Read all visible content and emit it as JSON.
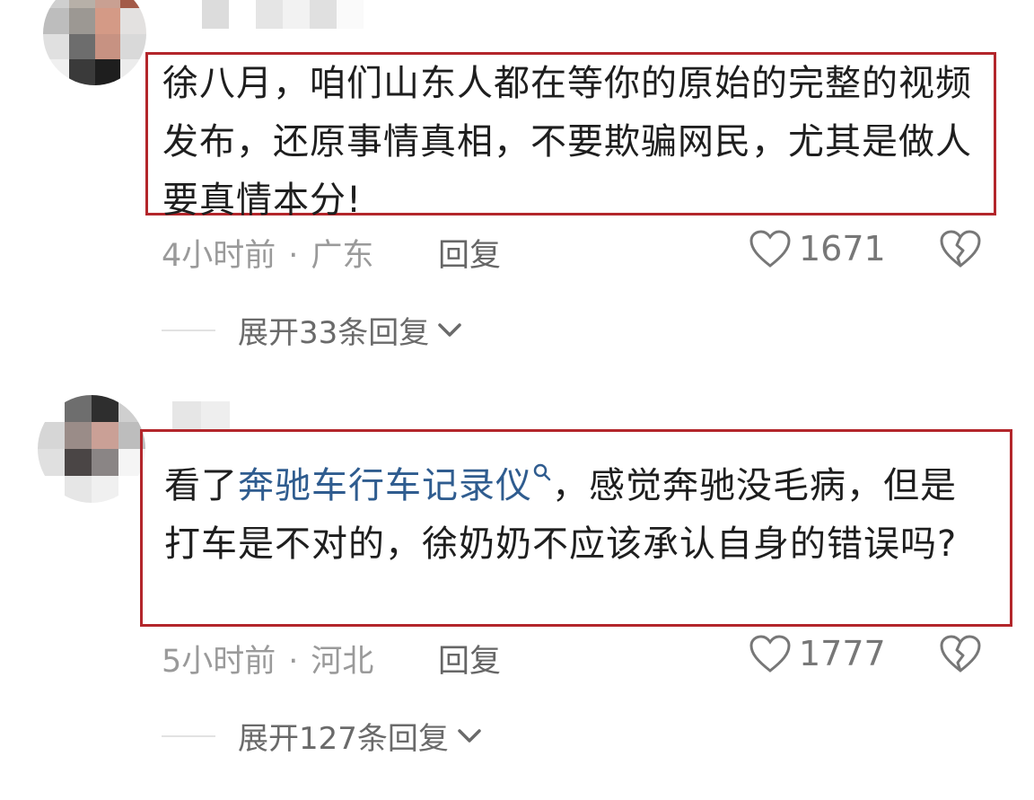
{
  "comments": [
    {
      "text": "徐八月，咱们山东人都在等你的原始的完整的视频发布，还原事情真相，不要欺骗网民，尤其是做人要真情本分!",
      "time": "4小时前",
      "dot": "·",
      "location": "广东",
      "reply_label": "回复",
      "likes": "1671",
      "expand_label": "展开33条回复"
    },
    {
      "text_before": "看了",
      "link_text": "奔驰车行车记录仪",
      "text_after": "，感觉奔驰没毛病，但是打车是不对的，徐奶奶不应该承认自身的错误吗?",
      "time": "5小时前",
      "dot": "·",
      "location": "河北",
      "reply_label": "回复",
      "likes": "1777",
      "expand_label": "展开127条回复"
    }
  ],
  "colors": {
    "highlight_border": "#b3262b",
    "link": "#2f5c8f"
  },
  "icons": [
    "heart-icon",
    "dislike-icon",
    "chevron-down-icon",
    "search-icon"
  ]
}
